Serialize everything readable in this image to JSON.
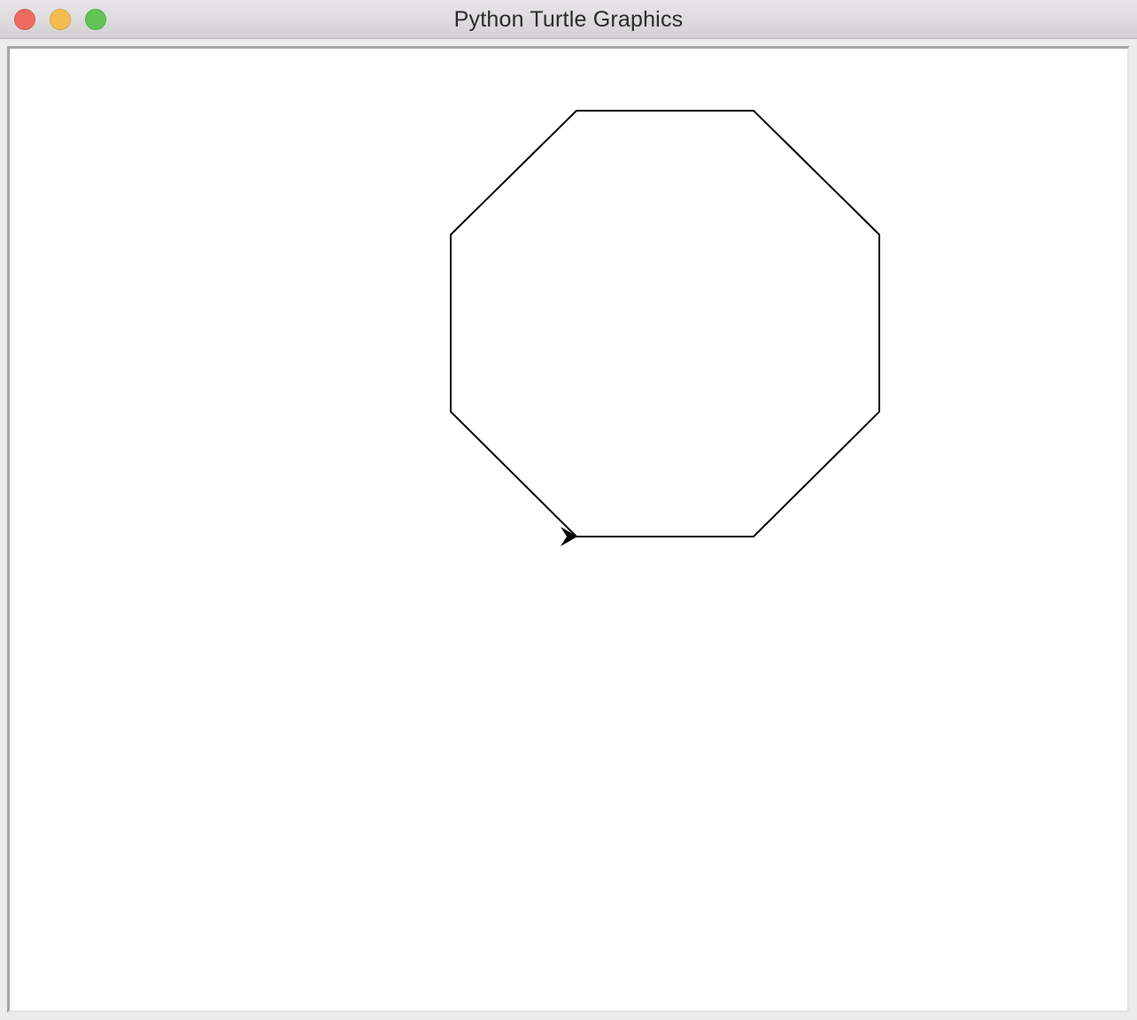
{
  "window": {
    "title": "Python Turtle Graphics",
    "buttons": {
      "close_color": "#ee6a5f",
      "minimize_color": "#f5bd4f",
      "zoom_color": "#61c454"
    }
  },
  "canvas": {
    "background": "#ffffff",
    "pen_color": "#000000",
    "turtle": {
      "icon": "turtle-arrow-icon",
      "heading_deg": 0
    },
    "drawing": {
      "shape": "regular octagon",
      "sides": 8,
      "turn_angle_deg": 45
    }
  }
}
